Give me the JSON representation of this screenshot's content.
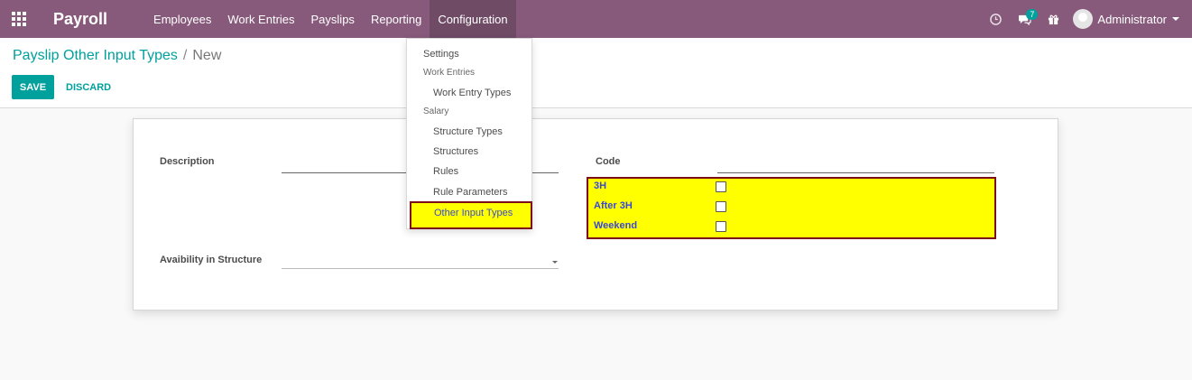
{
  "navbar": {
    "brand": "Payroll",
    "menu": [
      "Employees",
      "Work Entries",
      "Payslips",
      "Reporting",
      "Configuration"
    ],
    "messages_badge": "7",
    "user": "Administrator"
  },
  "control": {
    "breadcrumb_parent": "Payslip Other Input Types",
    "breadcrumb_sep": "/",
    "breadcrumb_current": "New",
    "save_label": "SAVE",
    "discard_label": "DISCARD"
  },
  "form": {
    "description_label": "Description",
    "code_label": "Code",
    "availability_label": "Avaibility in Structure",
    "options": [
      {
        "label": "3H",
        "checked": false
      },
      {
        "label": "After 3H",
        "checked": false
      },
      {
        "label": "Weekend",
        "checked": false
      }
    ]
  },
  "config_menu": {
    "settings": "Settings",
    "work_entries_header": "Work Entries",
    "work_entry_types": "Work Entry Types",
    "salary_header": "Salary",
    "structure_types": "Structure Types",
    "structures": "Structures",
    "rules": "Rules",
    "rule_parameters": "Rule Parameters",
    "other_input_types": "Other Input Types"
  },
  "colors": {
    "navbar": "#875a7b",
    "accent": "#00a09d",
    "highlight": "#ffff00",
    "highlight_border": "#7b0e16",
    "highlight_text": "#3a48d6"
  }
}
